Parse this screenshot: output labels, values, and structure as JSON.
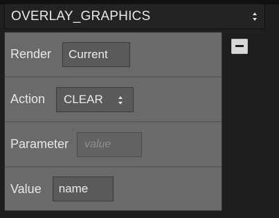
{
  "header": {
    "title": "OVERLAY_GRAPHICS",
    "selector_icon": "updown-chevron-icon"
  },
  "panel": {
    "rows": [
      {
        "label": "Render",
        "value": "Current",
        "kind": "text"
      },
      {
        "label": "Action",
        "value": "CLEAR",
        "kind": "select",
        "icon": "updown-chevron-icon"
      },
      {
        "label": "Parameter",
        "value": "",
        "placeholder": "value",
        "kind": "input"
      },
      {
        "label": "Value",
        "value": "name",
        "kind": "input"
      }
    ]
  },
  "controls": {
    "remove_icon": "minus-icon"
  },
  "colors": {
    "background": "#1e1e1e",
    "panel": "#6a6a6a",
    "field": "#5a5a5a",
    "button": "#d8d8d8"
  }
}
